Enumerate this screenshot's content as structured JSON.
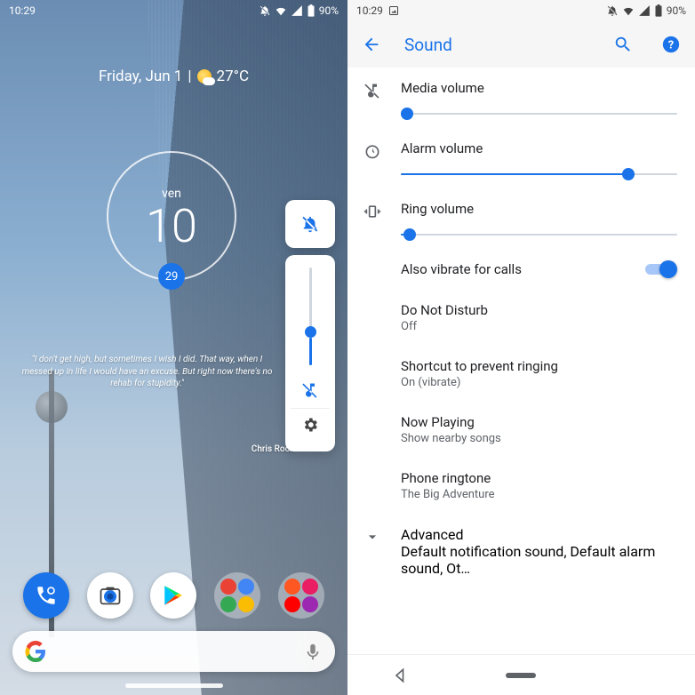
{
  "left": {
    "status": {
      "time": "10:29",
      "battery_pct": "90%"
    },
    "date_line": "Friday, Jun 1",
    "temp": "27°C",
    "clock": {
      "day_abbrev": "ven",
      "day_num": "10",
      "badge": "29"
    },
    "quote": "\"I don't get high, but sometimes I wish I did. That way, when I messed up in life I would have an excuse. But right now there's no rehab for stupidity.\"",
    "quote_author": "Chris Rock",
    "volume_slider": {
      "percent": 28
    }
  },
  "right": {
    "status": {
      "time": "10:29",
      "battery_pct": "90%"
    },
    "title": "Sound",
    "sliders": {
      "media": {
        "label": "Media volume",
        "percent": 3
      },
      "alarm": {
        "label": "Alarm volume",
        "percent": 82
      },
      "ring": {
        "label": "Ring volume",
        "percent": 4
      }
    },
    "vibrate": {
      "label": "Also vibrate for calls",
      "on": true
    },
    "items": [
      {
        "title": "Do Not Disturb",
        "sub": "Off"
      },
      {
        "title": "Shortcut to prevent ringing",
        "sub": "On (vibrate)"
      },
      {
        "title": "Now Playing",
        "sub": "Show nearby songs"
      },
      {
        "title": "Phone ringtone",
        "sub": "The Big Adventure"
      }
    ],
    "advanced": {
      "title": "Advanced",
      "sub": "Default notification sound, Default alarm sound, Ot…"
    }
  }
}
